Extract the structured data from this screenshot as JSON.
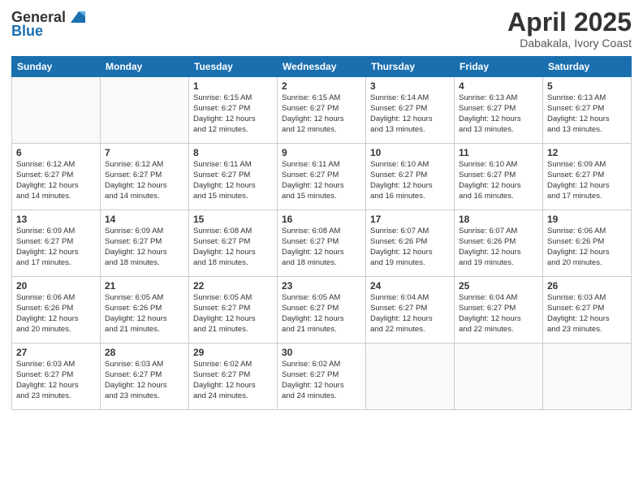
{
  "header": {
    "logo_general": "General",
    "logo_blue": "Blue",
    "month": "April 2025",
    "location": "Dabakala, Ivory Coast"
  },
  "weekdays": [
    "Sunday",
    "Monday",
    "Tuesday",
    "Wednesday",
    "Thursday",
    "Friday",
    "Saturday"
  ],
  "weeks": [
    [
      {
        "day": "",
        "info": ""
      },
      {
        "day": "",
        "info": ""
      },
      {
        "day": "1",
        "info": "Sunrise: 6:15 AM\nSunset: 6:27 PM\nDaylight: 12 hours\nand 12 minutes."
      },
      {
        "day": "2",
        "info": "Sunrise: 6:15 AM\nSunset: 6:27 PM\nDaylight: 12 hours\nand 12 minutes."
      },
      {
        "day": "3",
        "info": "Sunrise: 6:14 AM\nSunset: 6:27 PM\nDaylight: 12 hours\nand 13 minutes."
      },
      {
        "day": "4",
        "info": "Sunrise: 6:13 AM\nSunset: 6:27 PM\nDaylight: 12 hours\nand 13 minutes."
      },
      {
        "day": "5",
        "info": "Sunrise: 6:13 AM\nSunset: 6:27 PM\nDaylight: 12 hours\nand 13 minutes."
      }
    ],
    [
      {
        "day": "6",
        "info": "Sunrise: 6:12 AM\nSunset: 6:27 PM\nDaylight: 12 hours\nand 14 minutes."
      },
      {
        "day": "7",
        "info": "Sunrise: 6:12 AM\nSunset: 6:27 PM\nDaylight: 12 hours\nand 14 minutes."
      },
      {
        "day": "8",
        "info": "Sunrise: 6:11 AM\nSunset: 6:27 PM\nDaylight: 12 hours\nand 15 minutes."
      },
      {
        "day": "9",
        "info": "Sunrise: 6:11 AM\nSunset: 6:27 PM\nDaylight: 12 hours\nand 15 minutes."
      },
      {
        "day": "10",
        "info": "Sunrise: 6:10 AM\nSunset: 6:27 PM\nDaylight: 12 hours\nand 16 minutes."
      },
      {
        "day": "11",
        "info": "Sunrise: 6:10 AM\nSunset: 6:27 PM\nDaylight: 12 hours\nand 16 minutes."
      },
      {
        "day": "12",
        "info": "Sunrise: 6:09 AM\nSunset: 6:27 PM\nDaylight: 12 hours\nand 17 minutes."
      }
    ],
    [
      {
        "day": "13",
        "info": "Sunrise: 6:09 AM\nSunset: 6:27 PM\nDaylight: 12 hours\nand 17 minutes."
      },
      {
        "day": "14",
        "info": "Sunrise: 6:09 AM\nSunset: 6:27 PM\nDaylight: 12 hours\nand 18 minutes."
      },
      {
        "day": "15",
        "info": "Sunrise: 6:08 AM\nSunset: 6:27 PM\nDaylight: 12 hours\nand 18 minutes."
      },
      {
        "day": "16",
        "info": "Sunrise: 6:08 AM\nSunset: 6:27 PM\nDaylight: 12 hours\nand 18 minutes."
      },
      {
        "day": "17",
        "info": "Sunrise: 6:07 AM\nSunset: 6:26 PM\nDaylight: 12 hours\nand 19 minutes."
      },
      {
        "day": "18",
        "info": "Sunrise: 6:07 AM\nSunset: 6:26 PM\nDaylight: 12 hours\nand 19 minutes."
      },
      {
        "day": "19",
        "info": "Sunrise: 6:06 AM\nSunset: 6:26 PM\nDaylight: 12 hours\nand 20 minutes."
      }
    ],
    [
      {
        "day": "20",
        "info": "Sunrise: 6:06 AM\nSunset: 6:26 PM\nDaylight: 12 hours\nand 20 minutes."
      },
      {
        "day": "21",
        "info": "Sunrise: 6:05 AM\nSunset: 6:26 PM\nDaylight: 12 hours\nand 21 minutes."
      },
      {
        "day": "22",
        "info": "Sunrise: 6:05 AM\nSunset: 6:27 PM\nDaylight: 12 hours\nand 21 minutes."
      },
      {
        "day": "23",
        "info": "Sunrise: 6:05 AM\nSunset: 6:27 PM\nDaylight: 12 hours\nand 21 minutes."
      },
      {
        "day": "24",
        "info": "Sunrise: 6:04 AM\nSunset: 6:27 PM\nDaylight: 12 hours\nand 22 minutes."
      },
      {
        "day": "25",
        "info": "Sunrise: 6:04 AM\nSunset: 6:27 PM\nDaylight: 12 hours\nand 22 minutes."
      },
      {
        "day": "26",
        "info": "Sunrise: 6:03 AM\nSunset: 6:27 PM\nDaylight: 12 hours\nand 23 minutes."
      }
    ],
    [
      {
        "day": "27",
        "info": "Sunrise: 6:03 AM\nSunset: 6:27 PM\nDaylight: 12 hours\nand 23 minutes."
      },
      {
        "day": "28",
        "info": "Sunrise: 6:03 AM\nSunset: 6:27 PM\nDaylight: 12 hours\nand 23 minutes."
      },
      {
        "day": "29",
        "info": "Sunrise: 6:02 AM\nSunset: 6:27 PM\nDaylight: 12 hours\nand 24 minutes."
      },
      {
        "day": "30",
        "info": "Sunrise: 6:02 AM\nSunset: 6:27 PM\nDaylight: 12 hours\nand 24 minutes."
      },
      {
        "day": "",
        "info": ""
      },
      {
        "day": "",
        "info": ""
      },
      {
        "day": "",
        "info": ""
      }
    ]
  ]
}
